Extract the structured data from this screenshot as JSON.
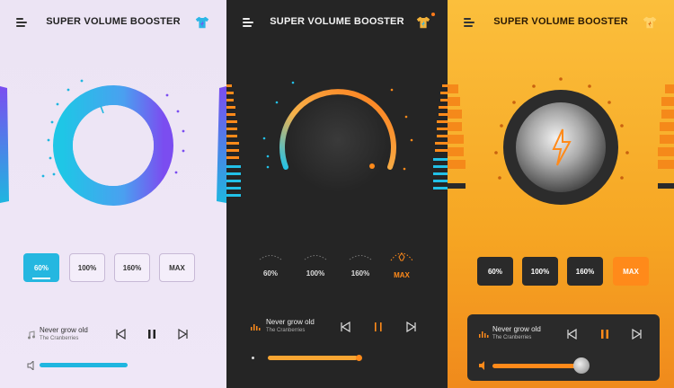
{
  "app": {
    "title": "SUPER VOLUME BOOSTER"
  },
  "presets": [
    "60%",
    "100%",
    "160%",
    "MAX"
  ],
  "track": {
    "title": "Never grow old",
    "artist": "The Cranberries"
  },
  "panels": [
    {
      "theme": "light",
      "selected_preset": "60%",
      "accent": "#1fb6e0",
      "accent2": "#7b4df0"
    },
    {
      "theme": "dark",
      "selected_preset": "MAX",
      "accent": "#ff8a1a",
      "accent2": "#22c1e8"
    },
    {
      "theme": "orange",
      "selected_preset": "MAX",
      "accent": "#ff8a1a",
      "accent2": "#2a2a2a"
    }
  ],
  "icons": [
    "menu-icon",
    "tshirt-icon",
    "previous-track-icon",
    "pause-icon",
    "next-track-icon",
    "volume-icon",
    "music-note-icon",
    "lightning-icon",
    "rocket-icon"
  ]
}
